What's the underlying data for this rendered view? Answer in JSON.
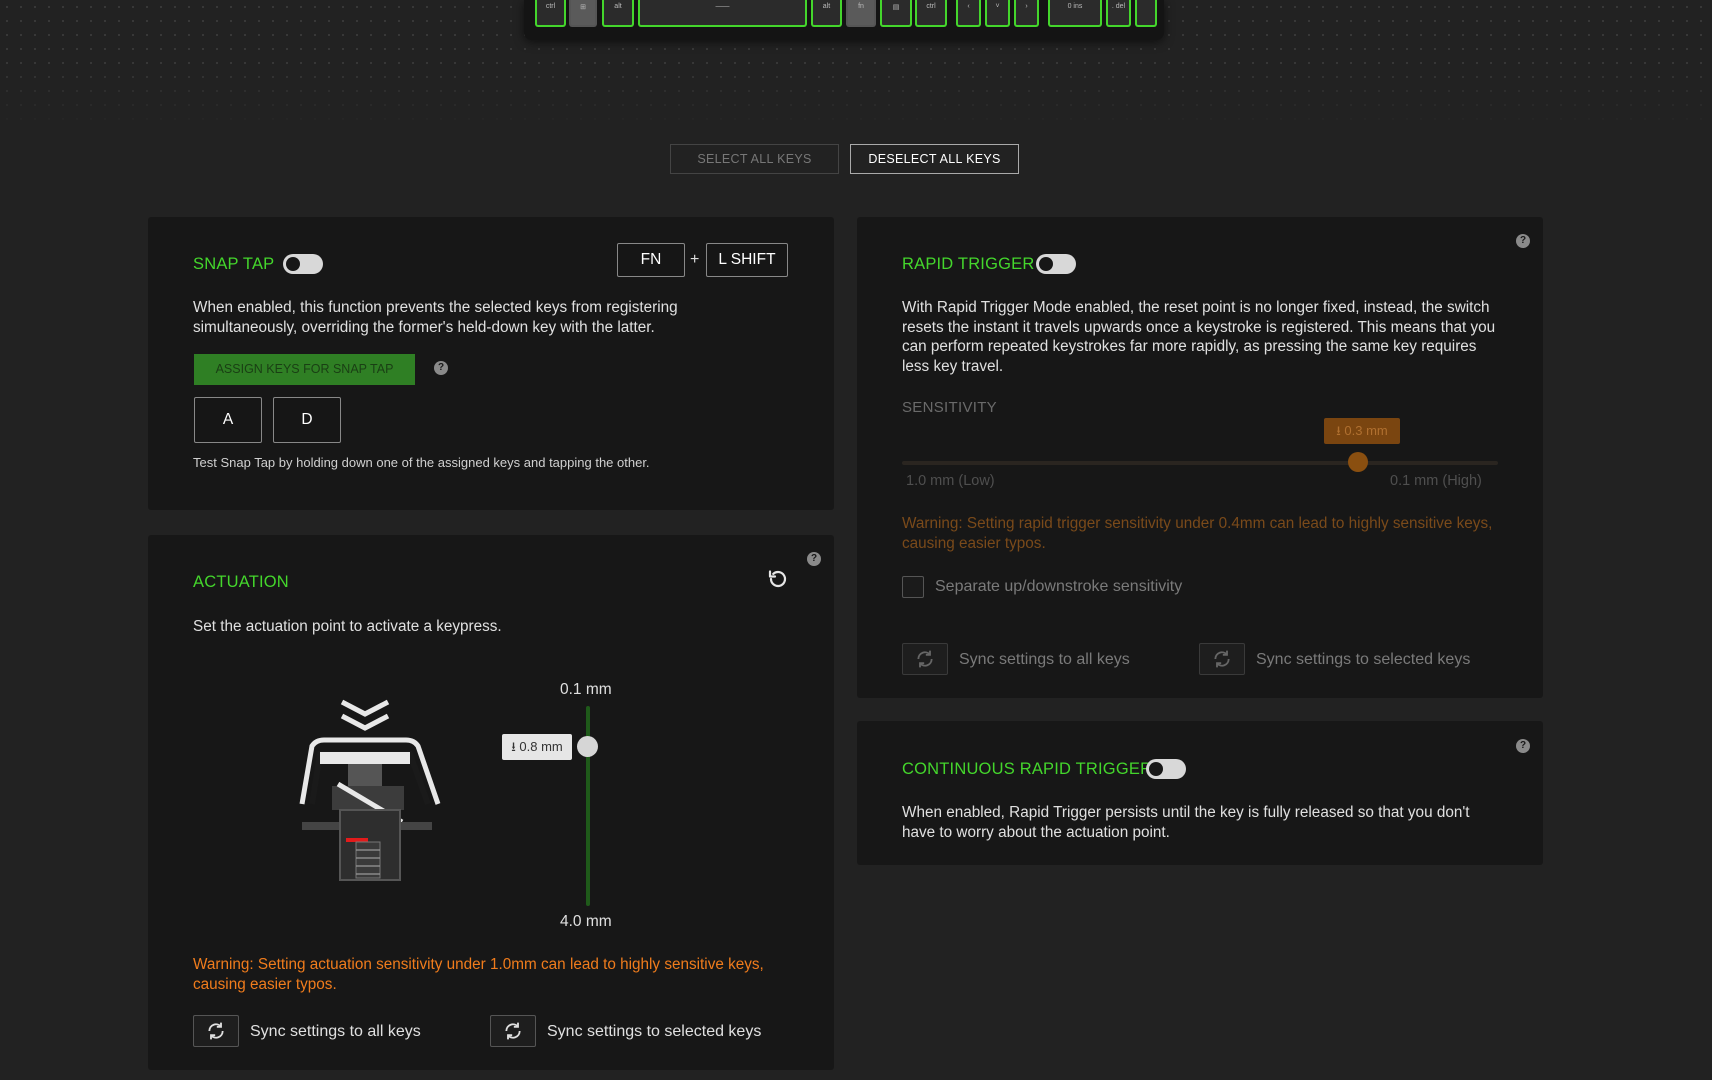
{
  "keyboard": {
    "keys": [
      "ctrl",
      "⊞",
      "alt",
      "——",
      "alt",
      "fn",
      "▤",
      "ctrl",
      "‹",
      "˅",
      "›",
      "0 ins",
      ". del",
      ""
    ]
  },
  "top_buttons": {
    "select_all": "SELECT ALL KEYS",
    "deselect_all": "DESELECT ALL KEYS"
  },
  "snap_tap": {
    "title": "SNAP TAP",
    "enabled": false,
    "shortcut_fn": "FN",
    "plus": "+",
    "shortcut_shift": "L SHIFT",
    "description": "When enabled, this function prevents the selected keys from registering simultaneously, overriding the former's held-down key with the latter.",
    "assign_label": "ASSIGN KEYS FOR SNAP TAP",
    "help": "?",
    "keys": [
      "A",
      "D"
    ],
    "test_hint": "Test Snap Tap by holding down one of the assigned keys and tapping the other."
  },
  "actuation": {
    "title": "ACTUATION",
    "help": "?",
    "reset_icon": "reset-icon",
    "description": "Set the actuation point to activate a keypress.",
    "top_label": "0.1 mm",
    "bottom_label": "4.0 mm",
    "value_label": "0.8 mm",
    "value_fraction": 0.18,
    "warning": "Warning: Setting actuation sensitivity under 1.0mm can lead to highly sensitive keys, causing easier typos.",
    "sync_all": "Sync settings to all keys",
    "sync_selected": "Sync settings to selected keys",
    "accent": "#44d62c"
  },
  "rapid_trigger": {
    "title": "RAPID TRIGGER",
    "enabled": false,
    "help": "?",
    "description": "With Rapid Trigger Mode enabled, the reset point is no longer fixed, instead, the switch resets the instant it travels upwards once a keystroke is registered. This means that you can perform repeated keystrokes far more rapidly, as pressing the same key requires less key travel.",
    "sensitivity_label": "SENSITIVITY",
    "value_label": "0.3 mm",
    "value_fraction": 0.75,
    "min_label": "1.0 mm (Low)",
    "max_label": "0.1 mm (High)",
    "warning": "Warning: Setting rapid trigger sensitivity under 0.4mm can lead to highly sensitive keys, causing easier typos.",
    "separate_label": "Separate up/downstroke sensitivity",
    "sync_all": "Sync settings to all keys",
    "sync_selected": "Sync settings to selected keys"
  },
  "continuous_rapid_trigger": {
    "title": "CONTINUOUS RAPID TRIGGER",
    "enabled": false,
    "help": "?",
    "description": "When enabled, Rapid Trigger persists until the key is fully released so that you don't have to worry about the actuation point."
  }
}
